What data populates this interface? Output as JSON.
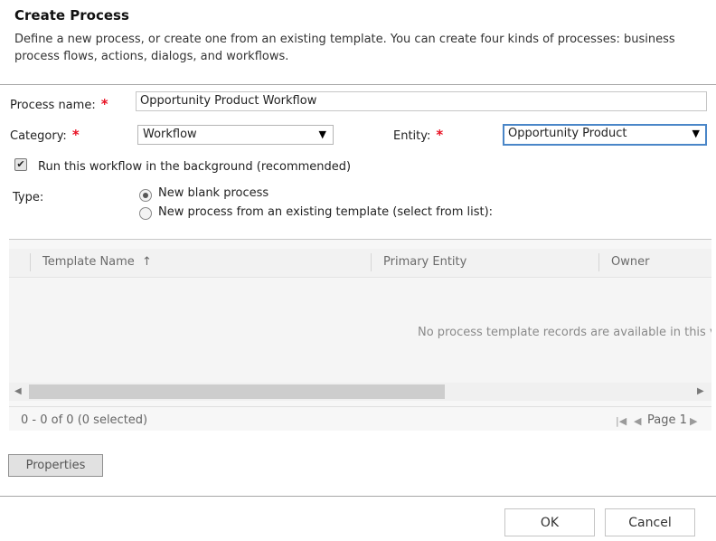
{
  "dialog": {
    "title": "Create Process",
    "description": "Define a new process, or create one from an existing template. You can create four kinds of processes: business process flows, actions, dialogs, and workflows."
  },
  "form": {
    "process_name_label": "Process name:",
    "process_name_value": "Opportunity Product Workflow",
    "category_label": "Category:",
    "category_value": "Workflow",
    "entity_label": "Entity:",
    "entity_value": "Opportunity Product",
    "required_marker": "*",
    "background_checkbox_label": "Run this workflow in the background (recommended)",
    "background_checked": true,
    "type_label": "Type:",
    "type_options": [
      {
        "label": "New blank process",
        "selected": true
      },
      {
        "label": "New process from an existing template (select from list):",
        "selected": false
      }
    ]
  },
  "grid": {
    "columns": [
      "Template Name",
      "Primary Entity",
      "Owner"
    ],
    "sort_indicator": "↑",
    "empty_message": "No process template records are available in this view.",
    "record_count": "0 - 0 of 0 (0 selected)",
    "page_label": "Page 1"
  },
  "buttons": {
    "properties": "Properties",
    "ok": "OK",
    "cancel": "Cancel"
  }
}
